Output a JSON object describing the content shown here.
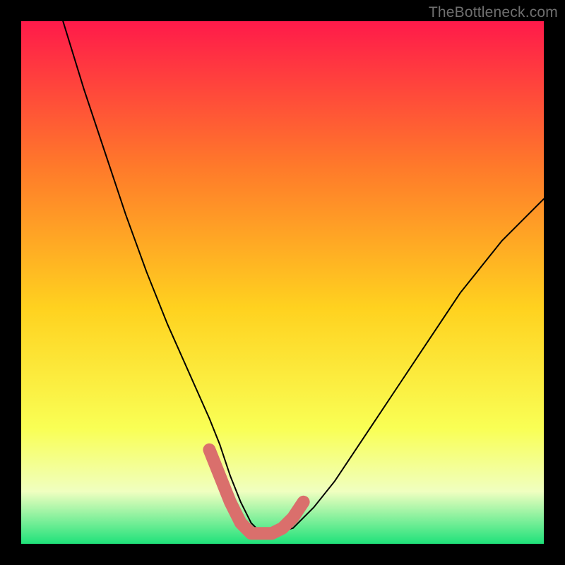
{
  "watermark": "TheBottleneck.com",
  "colors": {
    "frame": "#000000",
    "curve": "#000000",
    "marker": "#da6f6c",
    "gradient_top": "#ff1a4a",
    "gradient_upper_mid": "#ff7a2a",
    "gradient_mid": "#ffd21f",
    "gradient_lower_mid": "#f9ff55",
    "gradient_band_pale": "#f0ffc0",
    "gradient_bottom": "#1fe27a"
  },
  "chart_data": {
    "type": "line",
    "title": "",
    "xlabel": "",
    "ylabel": "",
    "xlim": [
      0,
      100
    ],
    "ylim": [
      0,
      100
    ],
    "x": [
      8,
      12,
      16,
      20,
      24,
      28,
      32,
      36,
      38,
      40,
      42,
      44,
      46,
      48,
      52,
      56,
      60,
      64,
      68,
      72,
      76,
      80,
      84,
      88,
      92,
      96,
      100
    ],
    "values": [
      100,
      87,
      75,
      63,
      52,
      42,
      33,
      24,
      19,
      13,
      8,
      4,
      2,
      2,
      3,
      7,
      12,
      18,
      24,
      30,
      36,
      42,
      48,
      53,
      58,
      62,
      66
    ],
    "markers": {
      "x": [
        36,
        38,
        40,
        42,
        44,
        46,
        48,
        50,
        52,
        54
      ],
      "y": [
        18,
        13,
        8,
        4,
        2,
        2,
        2,
        3,
        5,
        8
      ]
    }
  }
}
